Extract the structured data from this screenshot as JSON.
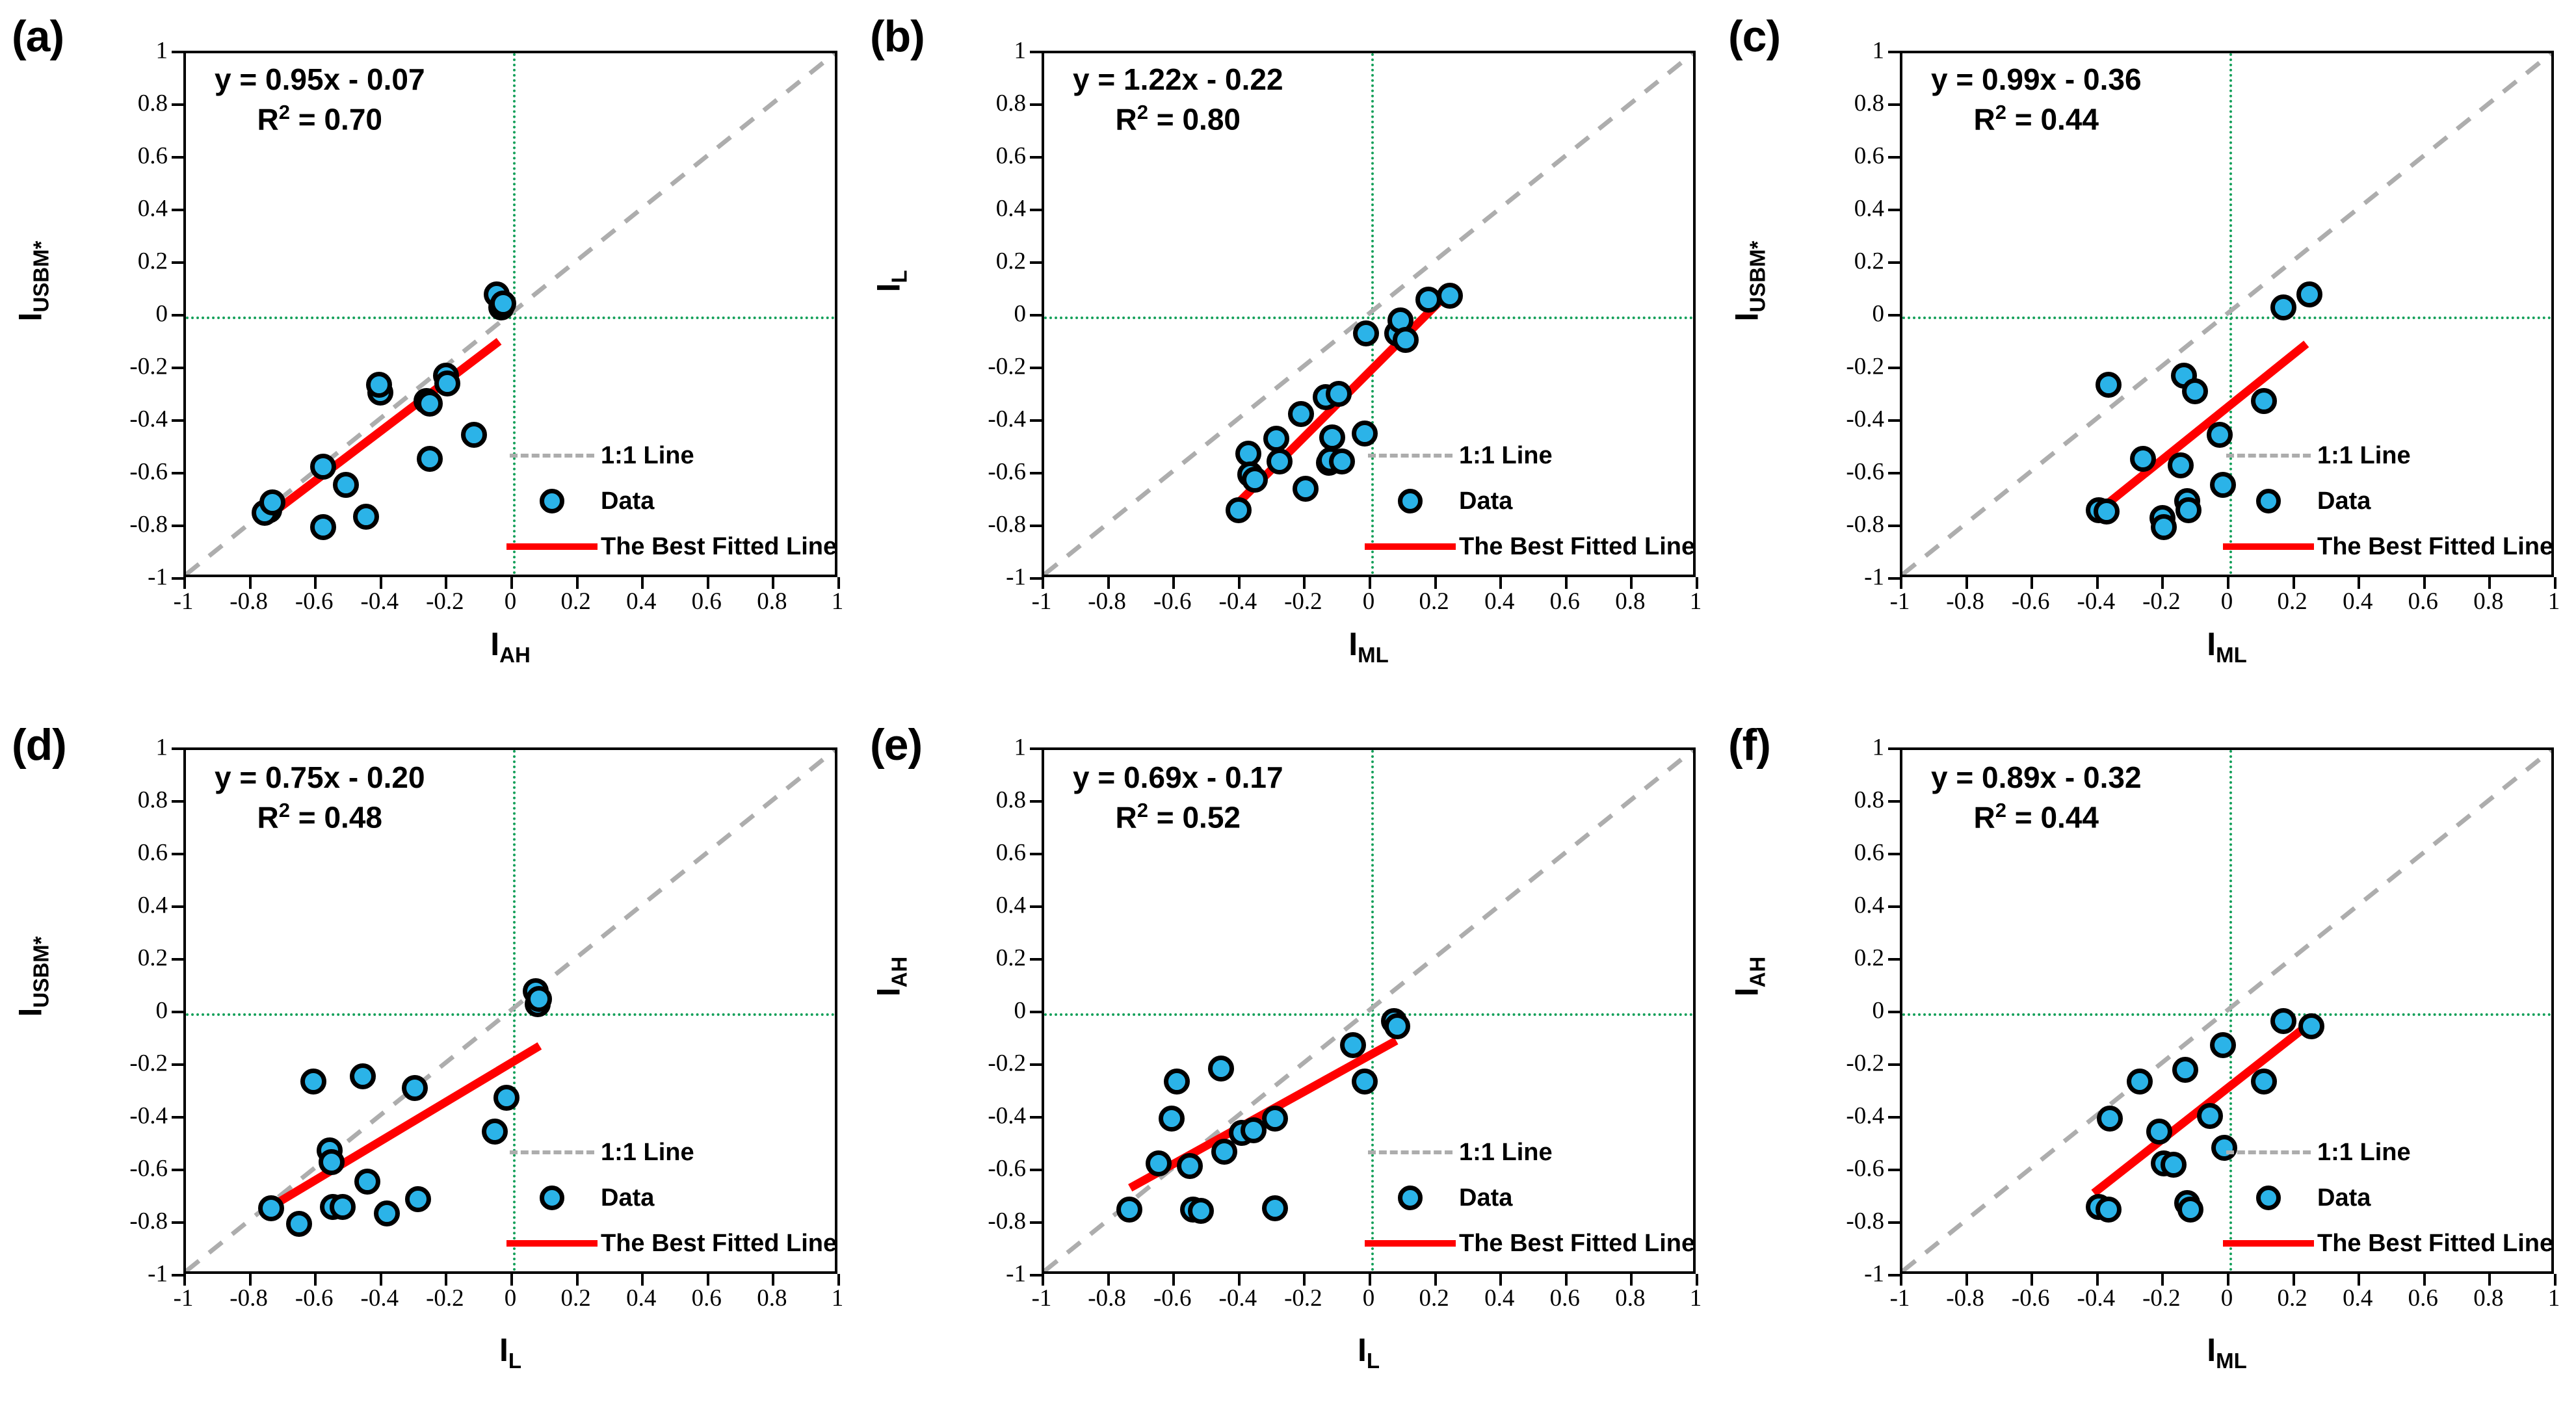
{
  "figure": {
    "panel_count": 6,
    "axis_range": [
      -1,
      1
    ],
    "tick_values": [
      "-1",
      "-0.8",
      "-0.6",
      "-0.4",
      "-0.2",
      "0",
      "0.2",
      "0.4",
      "0.6",
      "0.8",
      "1"
    ],
    "colors": {
      "marker_fill": "#2BB3E8",
      "marker_edge": "#000000",
      "fit_line": "#FF0000",
      "one_to_one_line": "#ADADAD",
      "zero_line": "#14A05A",
      "frame": "#000000"
    },
    "legend": {
      "one_to_one_label": "1:1 Line",
      "data_label": "Data",
      "fit_label": "The Best Fitted Line"
    }
  },
  "chart_data": [
    {
      "type": "scatter",
      "panel": "(a)",
      "title": "",
      "equation": "y = 0.95x - 0.07",
      "r_squared_label": "R² = 0.70",
      "slope": 0.95,
      "intercept": -0.07,
      "r_squared": 0.7,
      "xlabel": "I",
      "xlabel_sub": "AH",
      "ylabel": "I",
      "ylabel_sub": "USBM*",
      "xlim": [
        -1,
        1
      ],
      "ylim": [
        -1,
        1
      ],
      "grid": false,
      "legend_position": "bottom-right",
      "fit_segment": {
        "x0": -0.755,
        "y0": -0.785,
        "x1": -0.035,
        "y1": -0.105
      },
      "points": [
        {
          "x": -0.745,
          "y": -0.735
        },
        {
          "x": -0.76,
          "y": -0.745
        },
        {
          "x": -0.735,
          "y": -0.705
        },
        {
          "x": -0.58,
          "y": -0.57
        },
        {
          "x": -0.58,
          "y": -0.8
        },
        {
          "x": -0.51,
          "y": -0.64
        },
        {
          "x": -0.45,
          "y": -0.76
        },
        {
          "x": -0.405,
          "y": -0.29
        },
        {
          "x": -0.41,
          "y": -0.26
        },
        {
          "x": -0.265,
          "y": -0.32
        },
        {
          "x": -0.255,
          "y": -0.33
        },
        {
          "x": -0.255,
          "y": -0.54
        },
        {
          "x": -0.205,
          "y": -0.225
        },
        {
          "x": -0.2,
          "y": -0.255
        },
        {
          "x": -0.12,
          "y": -0.45
        },
        {
          "x": -0.05,
          "y": 0.085
        },
        {
          "x": -0.035,
          "y": 0.035
        },
        {
          "x": -0.03,
          "y": 0.05
        }
      ]
    },
    {
      "type": "scatter",
      "panel": "(b)",
      "equation": "y = 1.22x - 0.22",
      "r_squared_label": "R² = 0.80",
      "slope": 1.22,
      "intercept": -0.22,
      "r_squared": 0.8,
      "xlabel": "I",
      "xlabel_sub": "ML",
      "ylabel": "I",
      "ylabel_sub": "L",
      "xlim": [
        -1,
        1
      ],
      "ylim": [
        -1,
        1
      ],
      "grid": false,
      "legend_position": "bottom-right",
      "fit_segment": {
        "x0": -0.41,
        "y0": -0.735,
        "x1": 0.245,
        "y1": 0.08
      },
      "points": [
        {
          "x": -0.405,
          "y": -0.735
        },
        {
          "x": -0.375,
          "y": -0.52
        },
        {
          "x": -0.37,
          "y": -0.6
        },
        {
          "x": -0.355,
          "y": -0.62
        },
        {
          "x": -0.29,
          "y": -0.465
        },
        {
          "x": -0.28,
          "y": -0.55
        },
        {
          "x": -0.215,
          "y": -0.37
        },
        {
          "x": -0.2,
          "y": -0.655
        },
        {
          "x": -0.14,
          "y": -0.305
        },
        {
          "x": -0.13,
          "y": -0.555
        },
        {
          "x": -0.125,
          "y": -0.545
        },
        {
          "x": -0.12,
          "y": -0.46
        },
        {
          "x": -0.1,
          "y": -0.295
        },
        {
          "x": -0.09,
          "y": -0.55
        },
        {
          "x": -0.02,
          "y": -0.445
        },
        {
          "x": -0.015,
          "y": -0.065
        },
        {
          "x": 0.08,
          "y": -0.065
        },
        {
          "x": 0.09,
          "y": -0.015
        },
        {
          "x": 0.105,
          "y": -0.09
        },
        {
          "x": 0.175,
          "y": 0.065
        },
        {
          "x": 0.24,
          "y": 0.08
        }
      ]
    },
    {
      "type": "scatter",
      "panel": "(c)",
      "equation": "y = 0.99x - 0.36",
      "r_squared_label": "R² = 0.44",
      "slope": 0.99,
      "intercept": -0.36,
      "r_squared": 0.44,
      "xlabel": "I",
      "xlabel_sub": "ML",
      "ylabel": "I",
      "ylabel_sub": "USBM*",
      "xlim": [
        -1,
        1
      ],
      "ylim": [
        -1,
        1
      ],
      "grid": false,
      "legend_position": "bottom-right",
      "fit_segment": {
        "x0": -0.41,
        "y0": -0.77,
        "x1": 0.245,
        "y1": -0.115
      },
      "points": [
        {
          "x": -0.4,
          "y": -0.735
        },
        {
          "x": -0.375,
          "y": -0.74
        },
        {
          "x": -0.37,
          "y": -0.26
        },
        {
          "x": -0.265,
          "y": -0.54
        },
        {
          "x": -0.205,
          "y": -0.765
        },
        {
          "x": -0.2,
          "y": -0.8
        },
        {
          "x": -0.15,
          "y": -0.565
        },
        {
          "x": -0.14,
          "y": -0.225
        },
        {
          "x": -0.13,
          "y": -0.7
        },
        {
          "x": -0.125,
          "y": -0.735
        },
        {
          "x": -0.105,
          "y": -0.285
        },
        {
          "x": -0.03,
          "y": -0.45
        },
        {
          "x": -0.02,
          "y": -0.64
        },
        {
          "x": 0.105,
          "y": -0.32
        },
        {
          "x": 0.165,
          "y": 0.035
        },
        {
          "x": 0.245,
          "y": 0.085
        }
      ]
    },
    {
      "type": "scatter",
      "panel": "(d)",
      "equation": "y = 0.75x - 0.20",
      "r_squared_label": "R² = 0.48",
      "slope": 0.75,
      "intercept": -0.2,
      "r_squared": 0.48,
      "xlabel": "I",
      "xlabel_sub": "L",
      "ylabel": "I",
      "ylabel_sub": "USBM*",
      "xlim": [
        -1,
        1
      ],
      "ylim": [
        -1,
        1
      ],
      "grid": false,
      "legend_position": "bottom-right",
      "fit_segment": {
        "x0": -0.735,
        "y0": -0.75,
        "x1": 0.09,
        "y1": -0.135
      },
      "points": [
        {
          "x": -0.74,
          "y": -0.74
        },
        {
          "x": -0.655,
          "y": -0.8
        },
        {
          "x": -0.61,
          "y": -0.26
        },
        {
          "x": -0.56,
          "y": -0.52
        },
        {
          "x": -0.555,
          "y": -0.565
        },
        {
          "x": -0.55,
          "y": -0.735
        },
        {
          "x": -0.52,
          "y": -0.735
        },
        {
          "x": -0.46,
          "y": -0.24
        },
        {
          "x": -0.445,
          "y": -0.64
        },
        {
          "x": -0.385,
          "y": -0.76
        },
        {
          "x": -0.3,
          "y": -0.285
        },
        {
          "x": -0.29,
          "y": -0.705
        },
        {
          "x": -0.055,
          "y": -0.45
        },
        {
          "x": -0.02,
          "y": -0.32
        },
        {
          "x": 0.07,
          "y": 0.085
        },
        {
          "x": 0.075,
          "y": 0.035
        },
        {
          "x": 0.08,
          "y": 0.055
        }
      ]
    },
    {
      "type": "scatter",
      "panel": "(e)",
      "equation": "y = 0.69x - 0.17",
      "r_squared_label": "R² = 0.52",
      "slope": 0.69,
      "intercept": -0.17,
      "r_squared": 0.52,
      "xlabel": "I",
      "xlabel_sub": "L",
      "ylabel": "I",
      "ylabel_sub": "AH",
      "xlim": [
        -1,
        1
      ],
      "ylim": [
        -1,
        1
      ],
      "grid": false,
      "legend_position": "bottom-right",
      "fit_segment": {
        "x0": -0.735,
        "y0": -0.68,
        "x1": 0.085,
        "y1": -0.115
      },
      "points": [
        {
          "x": -0.74,
          "y": -0.745
        },
        {
          "x": -0.65,
          "y": -0.57
        },
        {
          "x": -0.61,
          "y": -0.4
        },
        {
          "x": -0.595,
          "y": -0.26
        },
        {
          "x": -0.555,
          "y": -0.58
        },
        {
          "x": -0.545,
          "y": -0.745
        },
        {
          "x": -0.52,
          "y": -0.75
        },
        {
          "x": -0.46,
          "y": -0.21
        },
        {
          "x": -0.45,
          "y": -0.525
        },
        {
          "x": -0.395,
          "y": -0.455
        },
        {
          "x": -0.36,
          "y": -0.445
        },
        {
          "x": -0.295,
          "y": -0.4
        },
        {
          "x": -0.295,
          "y": -0.74
        },
        {
          "x": -0.055,
          "y": -0.12
        },
        {
          "x": -0.02,
          "y": -0.26
        },
        {
          "x": 0.07,
          "y": -0.03
        },
        {
          "x": 0.08,
          "y": -0.05
        }
      ]
    },
    {
      "type": "scatter",
      "panel": "(f)",
      "equation": "y = 0.89x - 0.32",
      "r_squared_label": "R² = 0.44",
      "slope": 0.89,
      "intercept": -0.32,
      "r_squared": 0.44,
      "xlabel": "I",
      "xlabel_sub": "ML",
      "ylabel": "I",
      "ylabel_sub": "AH",
      "xlim": [
        -1,
        1
      ],
      "ylim": [
        -1,
        1
      ],
      "grid": false,
      "legend_position": "bottom-right",
      "fit_segment": {
        "x0": -0.41,
        "y0": -0.7,
        "x1": 0.25,
        "y1": -0.055
      },
      "points": [
        {
          "x": -0.4,
          "y": -0.735
        },
        {
          "x": -0.37,
          "y": -0.745
        },
        {
          "x": -0.365,
          "y": -0.4
        },
        {
          "x": -0.275,
          "y": -0.26
        },
        {
          "x": -0.215,
          "y": -0.45
        },
        {
          "x": -0.2,
          "y": -0.57
        },
        {
          "x": -0.17,
          "y": -0.575
        },
        {
          "x": -0.135,
          "y": -0.215
        },
        {
          "x": -0.13,
          "y": -0.72
        },
        {
          "x": -0.12,
          "y": -0.745
        },
        {
          "x": -0.06,
          "y": -0.39
        },
        {
          "x": -0.02,
          "y": -0.12
        },
        {
          "x": -0.015,
          "y": -0.51
        },
        {
          "x": 0.105,
          "y": -0.26
        },
        {
          "x": 0.165,
          "y": -0.03
        },
        {
          "x": 0.25,
          "y": -0.05
        }
      ]
    }
  ]
}
